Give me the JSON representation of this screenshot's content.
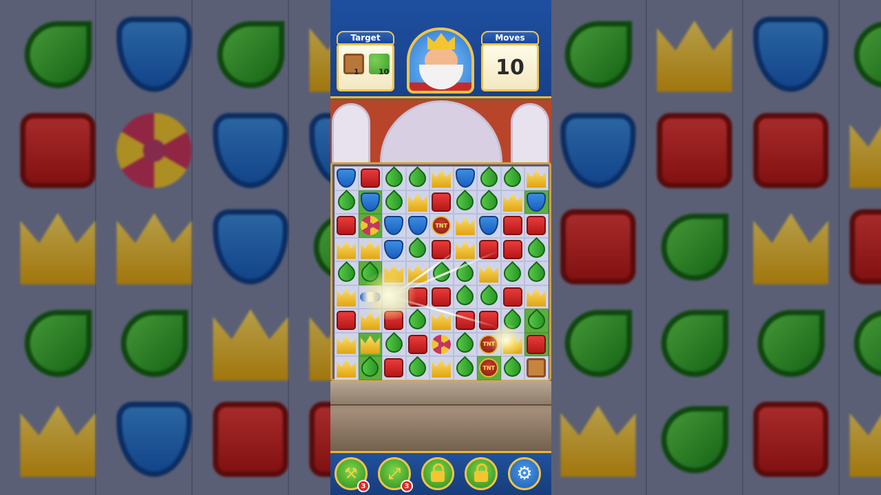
{
  "header": {
    "target_label": "Target",
    "moves_label": "Moves",
    "moves_value": "10",
    "targets": [
      {
        "icon": "crate-icon",
        "count": "1"
      },
      {
        "icon": "grass-icon",
        "count": "10"
      }
    ]
  },
  "colors": {
    "topbar": "#1f4fa0",
    "gold_border": "#f0c44a",
    "board_cell": "#cfd4ea",
    "grass": "#5cae3c"
  },
  "board": {
    "columns": 9,
    "rows": [
      [
        "shield",
        "box",
        "leaf",
        "leaf",
        "crown",
        "shield",
        "leaf",
        "leaf",
        "crown"
      ],
      [
        "leaf",
        "shield",
        "leaf",
        "crown",
        "box",
        "leaf",
        "leaf",
        "crown",
        "shield"
      ],
      [
        "box",
        "propeller",
        "shield",
        "shield",
        "tnt",
        "crown",
        "shield",
        "box",
        "box"
      ],
      [
        "crown",
        "crown",
        "shield",
        "leaf",
        "box",
        "crown",
        "box",
        "box",
        "leaf"
      ],
      [
        "leaf",
        "leaf",
        "crown",
        "crown",
        "leaf",
        "leaf",
        "crown",
        "leaf",
        "leaf"
      ],
      [
        "crown",
        "rocket",
        "empty",
        "box",
        "box",
        "leaf",
        "leaf",
        "box",
        "crown"
      ],
      [
        "box",
        "crown",
        "box",
        "leaf",
        "crown",
        "box",
        "box",
        "leaf",
        "leaf"
      ],
      [
        "crown",
        "crown",
        "leaf",
        "box",
        "propeller",
        "leaf",
        "tnt",
        "crown",
        "box"
      ],
      [
        "crown",
        "leaf",
        "box",
        "leaf",
        "crown",
        "leaf",
        "tnt",
        "leaf",
        "crate"
      ]
    ],
    "grass_cells": [
      [
        1,
        1
      ],
      [
        2,
        1
      ],
      [
        4,
        1
      ],
      [
        7,
        1
      ],
      [
        8,
        1
      ],
      [
        6,
        8
      ],
      [
        7,
        8
      ],
      [
        1,
        8
      ],
      [
        8,
        6
      ]
    ]
  },
  "backdrop": {
    "left": [
      "leaf",
      "shield",
      "leaf",
      "crown",
      "box",
      "propeller",
      "shield",
      "shield",
      "crown",
      "crown",
      "shield",
      "leaf",
      "leaf",
      "leaf",
      "crown",
      "crown",
      "crown",
      "shield",
      "box",
      "box"
    ],
    "right": [
      "leaf",
      "crown",
      "shield",
      "leaf",
      "shield",
      "box",
      "box",
      "crown",
      "box",
      "leaf",
      "crown",
      "box",
      "leaf",
      "leaf",
      "leaf",
      "leaf",
      "crown",
      "leaf",
      "box",
      "crown"
    ]
  },
  "boosters": [
    {
      "name": "hammer-booster",
      "icon": "hammer-icon",
      "badge": "3",
      "locked": false
    },
    {
      "name": "arrow-booster",
      "icon": "arrow-icon",
      "badge": "3",
      "locked": false
    },
    {
      "name": "locked-booster-1",
      "icon": "lock-icon",
      "badge": "",
      "locked": true
    },
    {
      "name": "locked-booster-2",
      "icon": "lock-icon",
      "badge": "",
      "locked": true
    },
    {
      "name": "settings-button",
      "icon": "gear-icon",
      "badge": "",
      "locked": false
    }
  ]
}
